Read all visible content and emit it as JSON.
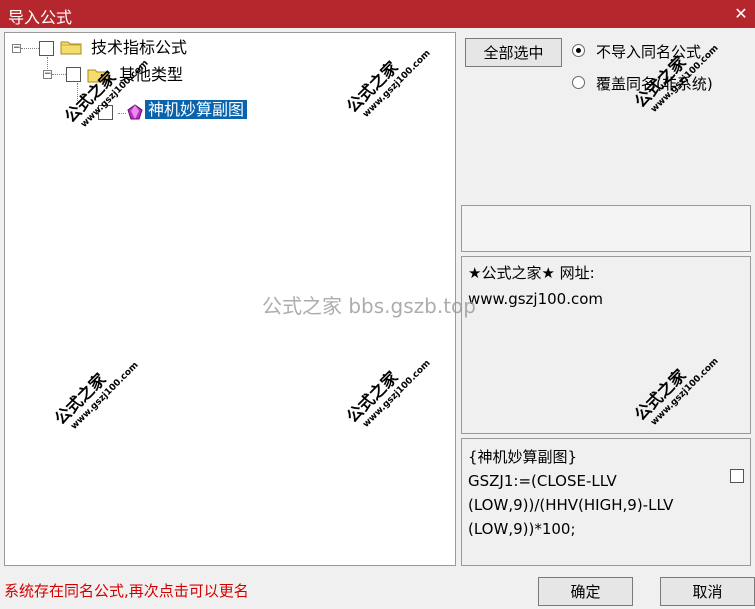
{
  "window": {
    "title": "导入公式",
    "close_symbol": "✕"
  },
  "tree": {
    "root": {
      "label": "技术指标公式",
      "expander": "−"
    },
    "child": {
      "label": "其他类型",
      "expander": "−"
    },
    "leaf": {
      "label": "神机妙算副图"
    }
  },
  "buttons": {
    "select_all": "全部选中",
    "ok": "确定",
    "cancel": "取消"
  },
  "options": {
    "no_import": "不导入同名公式",
    "overwrite": "覆盖同名(非系统)",
    "selected": "no_import"
  },
  "info": {
    "line1": "★公式之家★ 网址:",
    "line2": "www.gszj100.com"
  },
  "formula": {
    "lines": [
      "{神机妙算副图}",
      "GSZJ1:=(CLOSE-LLV",
      "(LOW,9))/(HHV(HIGH,9)-LLV",
      "(LOW,9))*100;"
    ]
  },
  "status": "系统存在同名公式,再次点击可以更名",
  "watermark": {
    "brand": "公式之家",
    "url": "www.gszj100.com",
    "center": "公式之家 bbs.gszb.top"
  }
}
